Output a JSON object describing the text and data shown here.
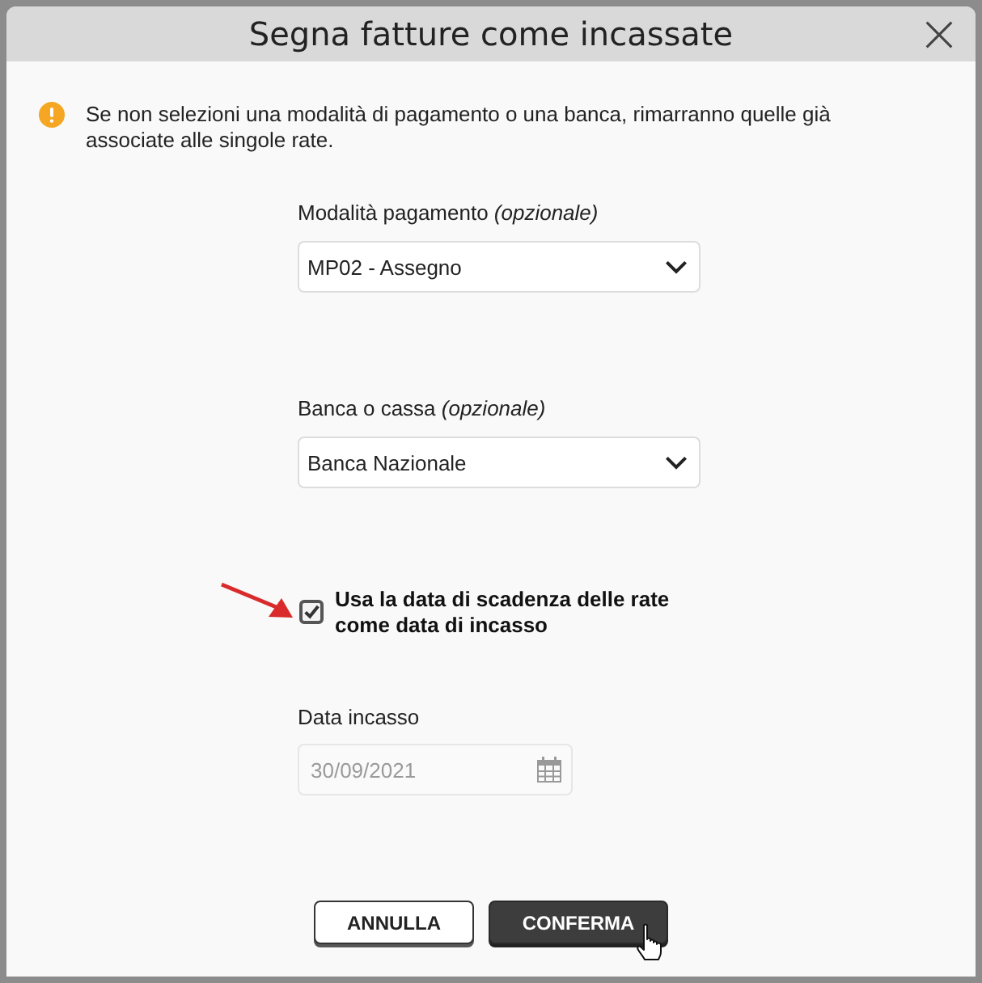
{
  "dialog": {
    "title": "Segna fatture come incassate"
  },
  "notice": {
    "text": "Se non selezioni una modalità di pagamento o una banca, rimarranno quelle già associate alle singole rate."
  },
  "fields": [
    {
      "kind": "select",
      "label": "Modalità pagamento *(opzionale)*",
      "value": "MP02 - Assegno"
    },
    {
      "kind": "select",
      "label": "Banca o cassa *(opzionale)*",
      "value": "Banca Nazionale"
    },
    {
      "kind": "checkbox",
      "label": "Usa la data di scadenza delle rate come data di incasso",
      "checked": true,
      "highlighted": true
    },
    {
      "kind": "date",
      "label": "Data incasso",
      "value": "30/09/2021",
      "disabled": true
    }
  ],
  "buttons": [
    {
      "label": "ANNULLA",
      "kind": "secondary",
      "hovered": false
    },
    {
      "label": "CONFERMA",
      "kind": "primary",
      "hovered": true
    }
  ]
}
